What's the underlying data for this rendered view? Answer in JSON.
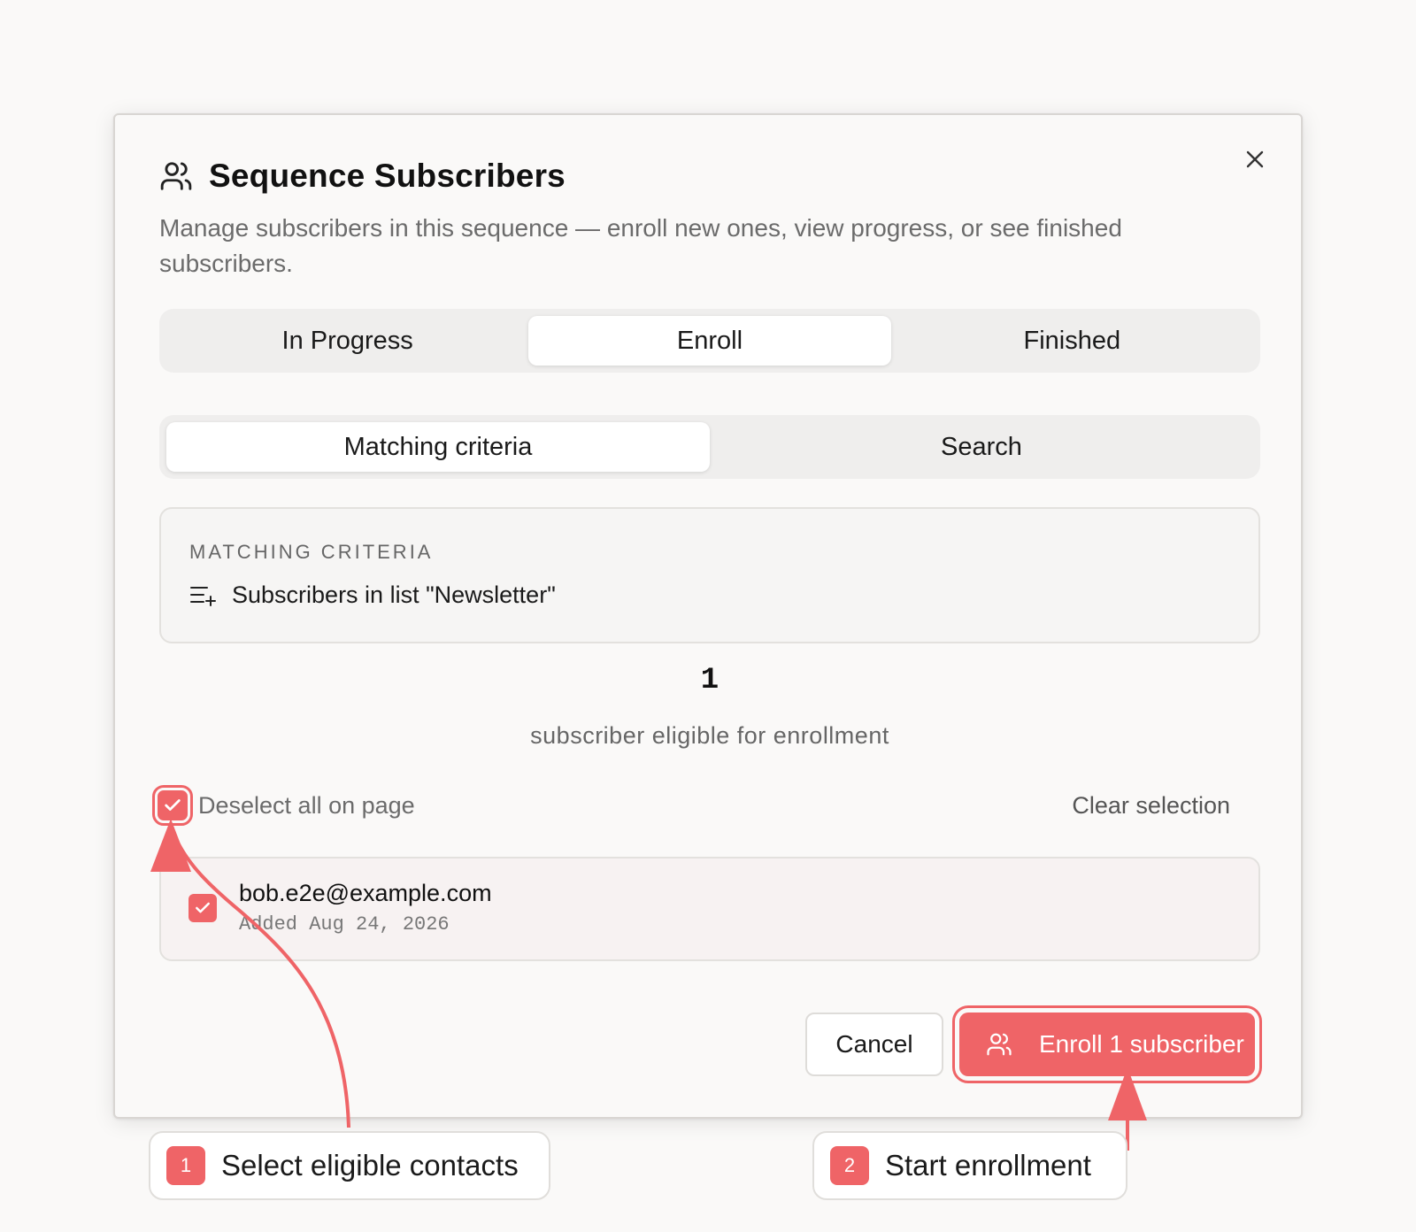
{
  "modal": {
    "title": "Sequence Subscribers",
    "subtitle": "Manage subscribers in this sequence — enroll new ones, view progress, or see finished subscribers.",
    "close_icon": "close-icon",
    "title_icon": "users-icon"
  },
  "tabs": [
    {
      "label": "In Progress",
      "active": false
    },
    {
      "label": "Enroll",
      "active": true
    },
    {
      "label": "Finished",
      "active": false
    }
  ],
  "subtabs": [
    {
      "label": "Matching criteria",
      "active": true
    },
    {
      "label": "Search",
      "active": false
    }
  ],
  "criteria": {
    "heading": "MATCHING CRITERIA",
    "item": "Subscribers in list \"Newsletter\"",
    "item_icon": "list-plus-icon"
  },
  "eligible": {
    "count": "1",
    "label": "subscriber eligible for enrollment"
  },
  "selection": {
    "toggle_label": "Deselect all on page",
    "checked": true,
    "clear_label": "Clear selection"
  },
  "subscribers": [
    {
      "email": "bob.e2e@example.com",
      "added": "Added Aug 24, 2026",
      "checked": true
    }
  ],
  "footer": {
    "cancel_label": "Cancel",
    "enroll_label": "Enroll 1 subscriber",
    "enroll_icon": "users-icon"
  },
  "annotations": [
    {
      "number": "1",
      "text": "Select eligible contacts"
    },
    {
      "number": "2",
      "text": "Start enrollment"
    }
  ],
  "colors": {
    "accent": "#ef6467",
    "background": "#faf9f8",
    "muted_text": "#6b6b6b"
  }
}
